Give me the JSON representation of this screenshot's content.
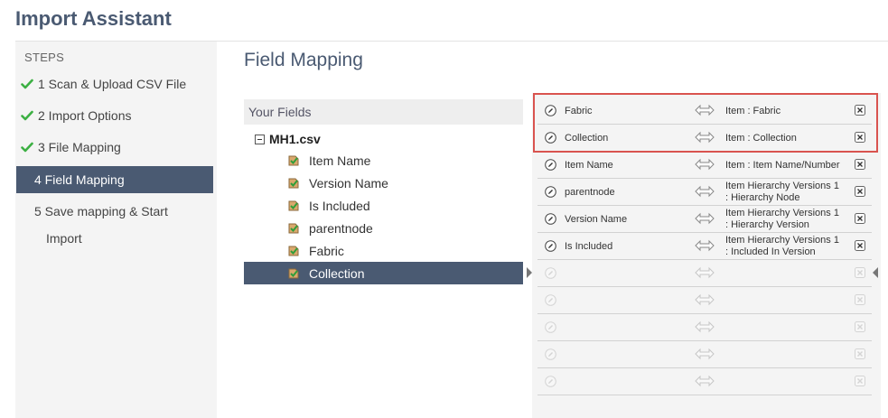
{
  "app": {
    "title": "Import Assistant"
  },
  "sidebar": {
    "steps_title": "STEPS",
    "steps": [
      {
        "label": "1 Scan & Upload CSV File",
        "completed": true
      },
      {
        "label": "2 Import Options",
        "completed": true
      },
      {
        "label": "3 File Mapping",
        "completed": true
      },
      {
        "label": "4 Field Mapping",
        "completed": false,
        "active": true
      },
      {
        "label_line1": "5 Save mapping & Start",
        "label_line2": "Import",
        "completed": false
      }
    ]
  },
  "main": {
    "title": "Field Mapping",
    "your_fields": {
      "header": "Your Fields",
      "root": "MH1.csv",
      "items": [
        {
          "label": "Item Name"
        },
        {
          "label": "Version Name"
        },
        {
          "label": "Is Included"
        },
        {
          "label": "parentnode"
        },
        {
          "label": "Fabric"
        },
        {
          "label": "Collection",
          "selected": true
        }
      ]
    },
    "mappings": [
      {
        "source": "Fabric",
        "target_line1": "Item : Fabric",
        "target_line2": ""
      },
      {
        "source": "Collection",
        "target_line1": "Item : Collection",
        "target_line2": ""
      },
      {
        "source": "Item Name",
        "target_line1": "Item : Item Name/Number",
        "target_line2": ""
      },
      {
        "source": "parentnode",
        "target_line1": "Item Hierarchy Versions 1",
        "target_line2": ": Hierarchy Node"
      },
      {
        "source": "Version Name",
        "target_line1": "Item Hierarchy Versions 1",
        "target_line2": ": Hierarchy Version"
      },
      {
        "source": "Is Included",
        "target_line1": "Item Hierarchy Versions 1",
        "target_line2": ": Included In Version"
      }
    ],
    "empty_rows": 5
  },
  "colors": {
    "accent": "#4a5a72",
    "check_green": "#3cb043",
    "highlight_red": "#d9534f"
  }
}
